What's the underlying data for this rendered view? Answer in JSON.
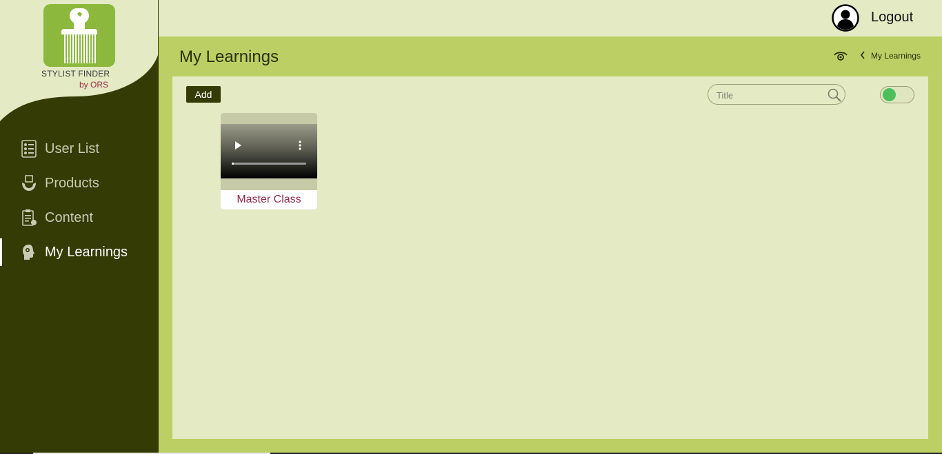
{
  "brand": {
    "line1": "STYLIST FINDER",
    "line2": "by ORS",
    "tile_color": "#8bb83d"
  },
  "sidebar": {
    "items": [
      {
        "label": "User List",
        "icon": "user-list-icon",
        "active": false
      },
      {
        "label": "Products",
        "icon": "products-icon",
        "active": false
      },
      {
        "label": "Content",
        "icon": "content-icon",
        "active": false
      },
      {
        "label": "My Learnings",
        "icon": "learning-icon",
        "active": true
      }
    ]
  },
  "topbar": {
    "logout_label": "Logout",
    "user_icon": "user-circle-icon"
  },
  "header": {
    "title": "My Learnings",
    "breadcrumb": {
      "home_icon": "eye-icon",
      "current": "My Learnings"
    }
  },
  "toolbar": {
    "add_label": "Add",
    "search_placeholder": "Title",
    "search_value": "",
    "toggle_on": true
  },
  "cards": [
    {
      "title": "Master Class",
      "media": "video"
    }
  ],
  "colors": {
    "sidebar_bg": "#343b04",
    "header_bg": "#bccf64",
    "panel_bg": "#e3eac4",
    "accent_text": "#8c2b4c",
    "toggle_knob": "#4cbf5c"
  }
}
